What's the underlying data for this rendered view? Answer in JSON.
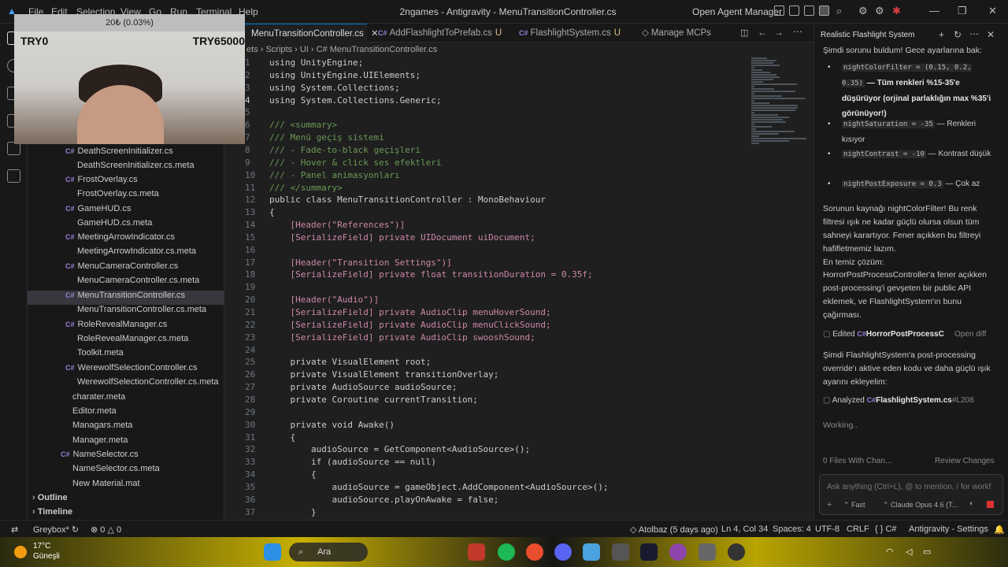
{
  "titlebar": {
    "menus": [
      "File",
      "Edit",
      "Selection",
      "View",
      "Go",
      "Run",
      "Terminal",
      "Help"
    ],
    "title": "2ngames - Antigravity - MenuTransitionController.cs",
    "agent_manager": "Open Agent Manager"
  },
  "webcam": {
    "banner": "20₺ (0.03%)",
    "left_label": "TRY0",
    "right_label": "TRY65000"
  },
  "explorer": {
    "files": [
      "DeathScreenInitializer.cs",
      "DeathScreenInitializer.cs.meta",
      "FrostOverlay.cs",
      "FrostOverlay.cs.meta",
      "GameHUD.cs",
      "GameHUD.cs.meta",
      "MeetingArrowIndicator.cs",
      "MeetingArrowIndicator.cs.meta",
      "MenuCameraController.cs",
      "MenuCameraController.cs.meta",
      "MenuTransitionController.cs",
      "MenuTransitionController.cs.meta",
      "RoleRevealManager.cs",
      "RoleRevealManager.cs.meta",
      "Toolkit.meta",
      "WerewolfSelectionController.cs",
      "WerewolfSelectionController.cs.meta"
    ],
    "files2": [
      "charater.meta",
      "Editor.meta",
      "Managars.meta",
      "Manager.meta",
      "NameSelector.cs",
      "NameSelector.cs.meta",
      "New Material.mat"
    ],
    "sections": [
      "Outline",
      "Timeline"
    ]
  },
  "tabs": [
    {
      "label": "MenuTransitionController.cs",
      "state": ""
    },
    {
      "label": "AddFlashlightToPrefab.cs",
      "state": "U"
    },
    {
      "label": "FlashlightSystem.cs",
      "state": "U"
    },
    {
      "label": "Manage MCPs",
      "state": ""
    }
  ],
  "breadcrumb": "ets  ›  Scripts  ›  UI  ›  C#  MenuTransitionController.cs",
  "code": {
    "line_numbers": [
      "1",
      "2",
      "3",
      "4",
      "5",
      "6",
      "7",
      "8",
      "9",
      "10",
      "11",
      "12",
      "13",
      "14",
      "15",
      "16",
      "17",
      "18",
      "19",
      "20",
      "21",
      "22",
      "23",
      "24",
      "25",
      "26",
      "27",
      "28",
      "29",
      "30",
      "31",
      "32",
      "33",
      "34",
      "35",
      "36",
      "37"
    ],
    "lines": [
      "using UnityEngine;",
      "using UnityEngine.UIElements;",
      "using System.Collections;",
      "using System.Collections.Generic;",
      "",
      "/// <summary>",
      "/// Menü geçiş sistemi",
      "/// - Fade-to-black geçişleri",
      "/// - Hover & click ses efektleri",
      "/// - Panel animasyonları",
      "/// </summary>",
      "public class MenuTransitionController : MonoBehaviour",
      "{",
      "    [Header(\"References\")]",
      "    [SerializeField] private UIDocument uiDocument;",
      "",
      "    [Header(\"Transition Settings\")]",
      "    [SerializeField] private float transitionDuration = 0.35f;",
      "",
      "    [Header(\"Audio\")]",
      "    [SerializeField] private AudioClip menuHoverSound;",
      "    [SerializeField] private AudioClip menuClickSound;",
      "    [SerializeField] private AudioClip swooshSound;",
      "",
      "    private VisualElement root;",
      "    private VisualElement transitionOverlay;",
      "    private AudioSource audioSource;",
      "    private Coroutine currentTransition;",
      "",
      "    private void Awake()",
      "    {",
      "        audioSource = GetComponent<AudioSource>();",
      "        if (audioSource == null)",
      "        {",
      "            audioSource = gameObject.AddComponent<AudioSource>();",
      "            audioSource.playOnAwake = false;",
      "        }"
    ]
  },
  "chat": {
    "title": "Realistic Flashlight System",
    "intro": "Şimdi sorunu buldum! Gece ayarlarına bak:",
    "bullets": [
      {
        "code": "nightColorFilter = (0.15, 0.2, 0.35)",
        "text": " — Tüm renkleri %15-35'e düşürüyor (orjinal parlaklığın max %35'i görünüyor!)"
      },
      {
        "code": "nightSaturation = -35",
        "text": " — Renkleri kısıyor"
      },
      {
        "code": "nightContrast = -10",
        "text": " — Kontrast düşük"
      },
      {
        "code": "nightPostExposure = 0.3",
        "text": " — Çok az"
      }
    ],
    "source_para": "Sorunun kaynağı nightColorFilter! Bu renk filtresi ışık ne kadar güçlü olursa olsun tüm sahneyi karartıyor. Fener açıkken bu filtreyi hafifletmemiz lazım.",
    "solution_label": "En temiz çözüm:",
    "solution": "HorrorPostProcessController'a fener açıkken post-processing'i gevşeten bir public API eklemek, ve FlashlightSystem'ın bunu çağırması.",
    "edited_label": "Edited",
    "edited_file": "HorrorPostProcessC",
    "open_diff": "Open diff",
    "next_para": "Şimdi FlashlightSystem'a post-processing override'ı aktive eden kodu ve daha güçlü ışık ayarını ekleyelim:",
    "analyzed_label": "Analyzed",
    "analyzed_file": "FlashlightSystem.cs",
    "analyzed_line": "#L208",
    "working": "Working..",
    "files_changed": "0 Files With Chan...",
    "review": "Review Changes",
    "input_placeholder": "Ask anything (Ctrl+L), @ to mention, / for workf",
    "mode": "Fast",
    "model": "Claude Opus 4.6 (T..."
  },
  "status": {
    "branch": "Greybox*",
    "problems": "0",
    "warnings": "0",
    "author": "Atolbaz (5 days ago)",
    "cursor": "Ln 4, Col 34",
    "spaces": "Spaces: 4",
    "encoding": "UTF-8",
    "eol": "CRLF",
    "lang": "C#",
    "app": "Antigravity - Settings"
  },
  "taskbar": {
    "temp": "17°C",
    "weather": "Güneşli",
    "search": "Ara"
  }
}
